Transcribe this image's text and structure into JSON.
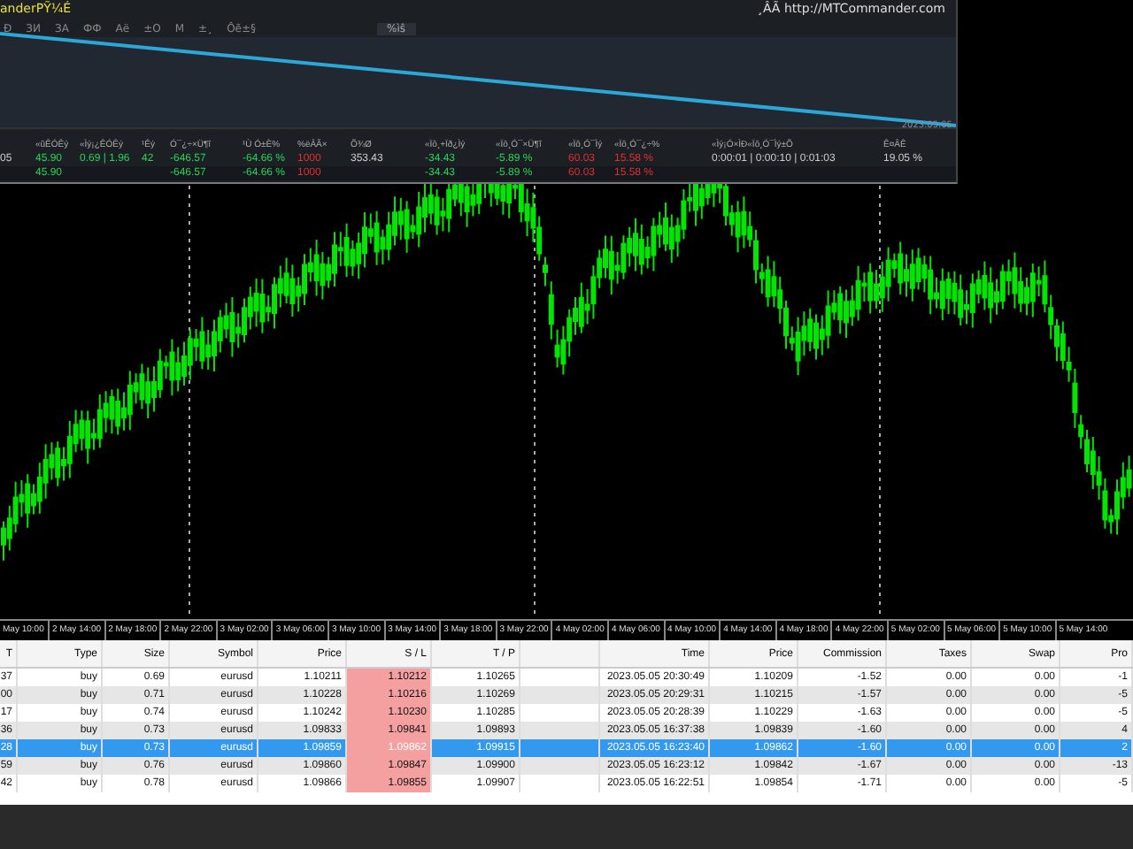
{
  "panel": {
    "title": "anderPỸ¼É",
    "link": "¸ÂÃ http://MTCommander.com",
    "toolbar": [
      "Ð",
      "ЗИ",
      "ЗА",
      "ФФ",
      "Аё",
      "±О",
      "М",
      "±¸",
      "Ôẽ±§"
    ],
    "toolbar_tag": "%ìŝ",
    "chart_date": "2023.05.05",
    "columns": [
      null,
      "«ûÊÓÊý",
      "«Ìý¡¿ÊÓÊý",
      "¹Êý",
      "Ó¯¿÷×Ü¶î",
      "¹Ù Ó±È%",
      "%ëÂÃ×",
      "Õ¾Ø",
      "«Ïô¸+Ïð¿Ìý",
      "«Ïô¸Ó¯×Ü¶î",
      "«Ïô¸Ó¯Ìý",
      "«Ïô¸Ó¯¿÷%",
      "«Ìý¡Ó×ÌÐ«Ïô¸Ó¯Ìý±Õ",
      "Ê¤ÂÊ"
    ],
    "rows": [
      [
        {
          "text": "05",
          "kind": "plain"
        },
        {
          "text": "45.90",
          "kind": "gain"
        },
        {
          "text": "0.69 | 1.96",
          "kind": "gain"
        },
        {
          "text": "42",
          "kind": "gain"
        },
        {
          "text": "-646.57",
          "kind": "gain"
        },
        {
          "text": "-64.66 %",
          "kind": "gain"
        },
        {
          "text": "1000",
          "kind": "loss"
        },
        {
          "text": "353.43",
          "kind": "plain"
        },
        {
          "text": "-34.43",
          "kind": "gain"
        },
        {
          "text": "-5.89 %",
          "kind": "gain"
        },
        {
          "text": "60.03",
          "kind": "loss"
        },
        {
          "text": "15.58 %",
          "kind": "loss"
        },
        {
          "text": "0:00:01 | 0:00:10 | 0:01:03",
          "kind": "plain"
        },
        {
          "text": "19.05 %",
          "kind": "plain"
        }
      ],
      [
        null,
        {
          "text": "45.90",
          "kind": "gain"
        },
        null,
        null,
        {
          "text": "-646.57",
          "kind": "gain"
        },
        {
          "text": "-64.66 %",
          "kind": "gain"
        },
        {
          "text": "1000",
          "kind": "loss"
        },
        null,
        {
          "text": "-34.43",
          "kind": "gain"
        },
        {
          "text": "-5.89 %",
          "kind": "gain"
        },
        {
          "text": "60.03",
          "kind": "loss"
        },
        {
          "text": "15.58 %",
          "kind": "loss"
        },
        null,
        null
      ]
    ]
  },
  "time_axis": [
    "May 10:00",
    "2 May 14:00",
    "2 May 18:00",
    "2 May 22:00",
    "3 May 02:00",
    "3 May 06:00",
    "3 May 10:00",
    "3 May 14:00",
    "3 May 18:00",
    "3 May 22:00",
    "4 May 02:00",
    "4 May 06:00",
    "4 May 10:00",
    "4 May 14:00",
    "4 May 18:00",
    "4 May 22:00",
    "5 May 02:00",
    "5 May 06:00",
    "5 May 10:00",
    "5 May 14:00"
  ],
  "trades": {
    "columns": [
      "T",
      "Type",
      "Size",
      "Symbol",
      "Price",
      "S / L",
      "T / P",
      null,
      "Time",
      "Price",
      "Commission",
      "Taxes",
      "Swap",
      "Pro"
    ],
    "rows": [
      {
        "selected": false,
        "cells": [
          "37",
          "buy",
          "0.69",
          "eurusd",
          "1.10211",
          "1.10212",
          "1.10265",
          null,
          "2023.05.05 20:30:49",
          "1.10209",
          "-1.52",
          "0.00",
          "0.00",
          "-1"
        ]
      },
      {
        "selected": false,
        "cells": [
          "00",
          "buy",
          "0.71",
          "eurusd",
          "1.10228",
          "1.10216",
          "1.10269",
          null,
          "2023.05.05 20:29:31",
          "1.10215",
          "-1.57",
          "0.00",
          "0.00",
          "-5"
        ]
      },
      {
        "selected": false,
        "cells": [
          "17",
          "buy",
          "0.74",
          "eurusd",
          "1.10242",
          "1.10230",
          "1.10285",
          null,
          "2023.05.05 20:28:39",
          "1.10229",
          "-1.63",
          "0.00",
          "0.00",
          "-5"
        ]
      },
      {
        "selected": false,
        "cells": [
          "36",
          "buy",
          "0.73",
          "eurusd",
          "1.09833",
          "1.09841",
          "1.09893",
          null,
          "2023.05.05 16:37:38",
          "1.09839",
          "-1.60",
          "0.00",
          "0.00",
          "4"
        ]
      },
      {
        "selected": true,
        "cells": [
          "28",
          "buy",
          "0.73",
          "eurusd",
          "1.09859",
          "1.09862",
          "1.09915",
          null,
          "2023.05.05 16:23:40",
          "1.09862",
          "-1.60",
          "0.00",
          "0.00",
          "2"
        ]
      },
      {
        "selected": false,
        "cells": [
          "59",
          "buy",
          "0.76",
          "eurusd",
          "1.09860",
          "1.09847",
          "1.09900",
          null,
          "2023.05.05 16:23:12",
          "1.09842",
          "-1.67",
          "0.00",
          "0.00",
          "-13"
        ]
      },
      {
        "selected": false,
        "cells": [
          "42",
          "buy",
          "0.78",
          "eurusd",
          "1.09866",
          "1.09855",
          "1.09907",
          null,
          "2023.05.05 16:22:51",
          "1.09854",
          "-1.71",
          "0.00",
          "0.00",
          "-5"
        ]
      }
    ]
  }
}
